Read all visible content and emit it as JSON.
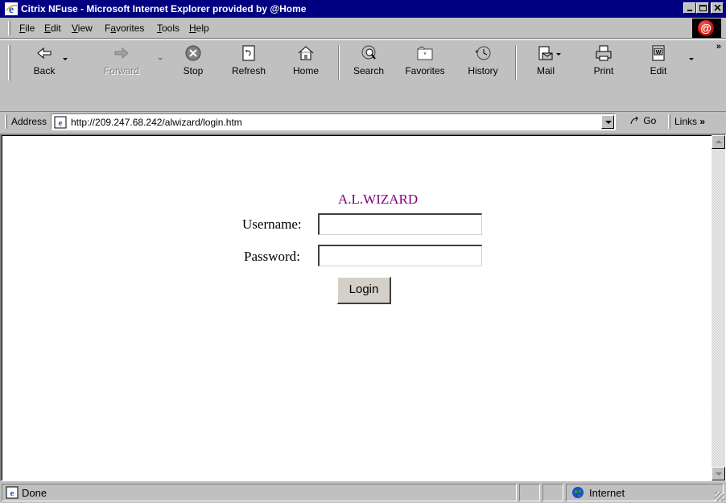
{
  "window": {
    "title": "Citrix NFuse - Microsoft Internet Explorer provided by @Home",
    "minimize_icon": "minimize-icon",
    "maximize_icon": "maximize-icon",
    "close_icon": "close-icon"
  },
  "menu": {
    "items": [
      {
        "label": "File",
        "accel": "F"
      },
      {
        "label": "Edit",
        "accel": "E"
      },
      {
        "label": "View",
        "accel": "V"
      },
      {
        "label": "Favorites",
        "accel": "a"
      },
      {
        "label": "Tools",
        "accel": "T"
      },
      {
        "label": "Help",
        "accel": "H"
      }
    ],
    "brand_logo_text": "@"
  },
  "toolbar": {
    "back": "Back",
    "forward": "Forward",
    "stop": "Stop",
    "refresh": "Refresh",
    "home": "Home",
    "search": "Search",
    "favorites": "Favorites",
    "history": "History",
    "mail": "Mail",
    "print": "Print",
    "edit": "Edit",
    "more": "»"
  },
  "address_bar": {
    "label": "Address",
    "url": "http://209.247.68.242/alwizard/login.htm",
    "go": "Go",
    "links": "Links",
    "links_more": "»"
  },
  "page": {
    "heading": "A.L.WIZARD",
    "username_label": "Username:",
    "username_value": "",
    "password_label": "Password:",
    "password_value": "",
    "login_button": "Login"
  },
  "status_bar": {
    "status": "Done",
    "zone": "Internet"
  },
  "colors": {
    "titlebar": "#000080",
    "chrome": "#c0c0c0",
    "heading": "#800080"
  }
}
